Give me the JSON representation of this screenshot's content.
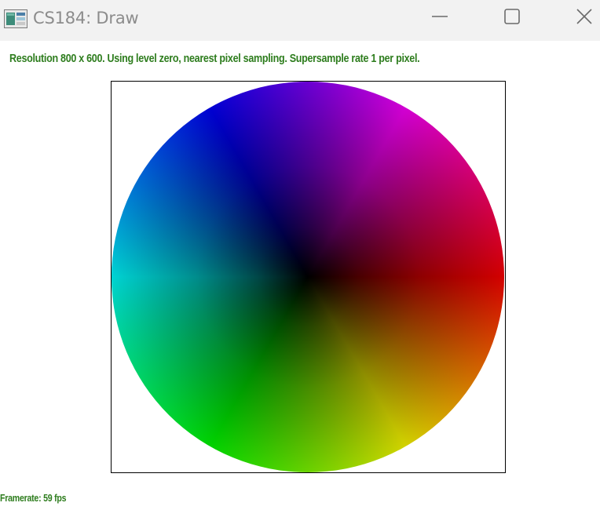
{
  "window": {
    "title": "CS184: Draw",
    "controls": {
      "minimize_icon": "minimize-icon",
      "maximize_icon": "maximize-icon",
      "close_icon": "close-icon"
    }
  },
  "status": {
    "text": "Resolution 800 x 600. Using level zero, nearest pixel sampling. Supersample rate 1 per pixel.",
    "color": "#2e7d1e"
  },
  "canvas": {
    "content": "color-wheel"
  },
  "footer": {
    "framerate": "Framerate: 59 fps"
  }
}
